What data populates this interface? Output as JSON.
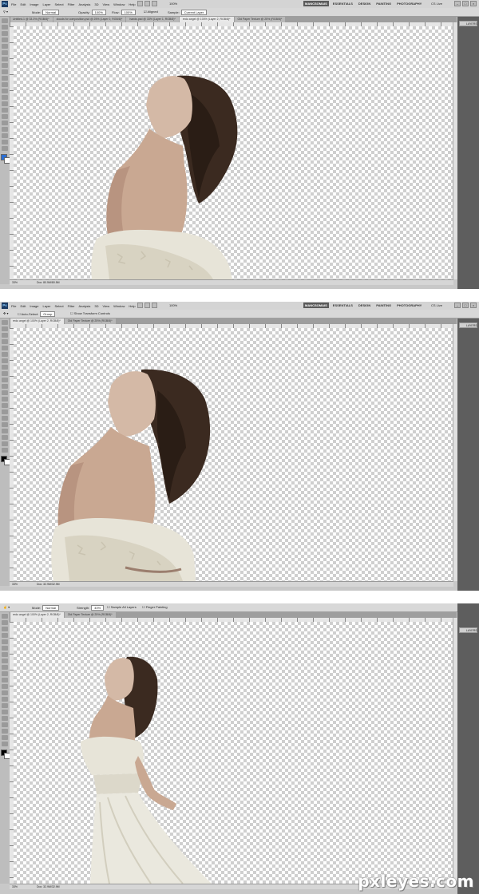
{
  "menu": [
    "File",
    "Edit",
    "Image",
    "Layer",
    "Select",
    "Filter",
    "Analysis",
    "3D",
    "View",
    "Window",
    "Help"
  ],
  "workspaces": [
    "MANCSOMAIS",
    "ESSENTIALS",
    "DESIGN",
    "PAINTING",
    "PHOTOGRAPHY"
  ],
  "cs_live": "CS Live",
  "zoom_select": "100%",
  "panels": [
    {
      "options": {
        "mode_label": "Mode:",
        "mode_value": "Normal",
        "opacity_label": "Opacity:",
        "opacity_value": "100%",
        "flow_label": "Flow:",
        "flow_value": "100%",
        "aligned": "Aligned",
        "sample_label": "Sample:",
        "sample_value": "Current Layer"
      },
      "tabs": [
        "Untitled-1 @ 33.3% (RGB/8)*",
        "clouds for composition.psd @ 25% (Layer 0, RGB/8)*",
        "hands.psd @ 33% (Layer 1, RGB/8)*",
        "redo angel @ 100% (Layer 2, RGB/8)*",
        "Old Paper Texture @ 25% (RGB/8)*"
      ],
      "zoom": "33%",
      "doc": "Doc: 80.5M/80.5M",
      "dock_label": "LAYERS"
    },
    {
      "options": {
        "auto_select": "Auto-Select:",
        "auto_value": "Group",
        "transform": "Show Transform Controls"
      },
      "tabs": [
        "redo angel @ 100% (Layer 2, RGB/8)*",
        "Old Paper Texture @ 25% (RGB/8)*"
      ],
      "zoom": "33%",
      "doc": "Doc: 32.9M/32.9M",
      "dock_label": "LAYERS"
    },
    {
      "options": {
        "mode_label": "Mode:",
        "mode_value": "Normal",
        "strength_label": "Strength:",
        "strength_value": "40%",
        "sample": "Sample All Layers",
        "finger": "Finger Painting"
      },
      "tabs": [
        "redo angel @ 100% (Layer 2, RGB/8)*",
        "Old Paper Texture @ 25% (RGB/8)*"
      ],
      "zoom": "33%",
      "doc": "Doc: 32.9M/32.9M",
      "dock_label": "LAYERS"
    }
  ],
  "watermark": "pxleyes.com",
  "colors": {
    "dock": "#5e5e5e",
    "active_workspace": "#5a5a5a",
    "fg_swatch_1": "#2a6fd6",
    "fg_swatch_2": "#000000"
  }
}
